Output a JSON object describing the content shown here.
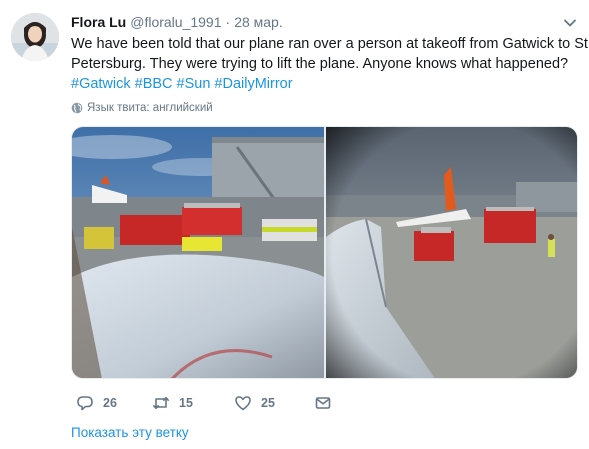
{
  "tweet": {
    "author": {
      "name": "Flora Lu",
      "handle": "@floralu_1991",
      "separator": "·",
      "date": "28 мар."
    },
    "text_lines": [
      "We have been told that our plane ran over a person at takeoff from Gatwick to St",
      "Petersburg. They were trying to lift the plane. Anyone knows what happened?"
    ],
    "hashtags": [
      "#Gatwick",
      "#BBC",
      "#Sun",
      "#DailyMirror"
    ],
    "language_note": "Язык твита: английский",
    "media": {
      "photo_count": 2
    },
    "actions": {
      "replies": "26",
      "retweets": "15",
      "likes": "25"
    },
    "show_thread": "Показать эту ветку"
  },
  "colors": {
    "link": "#1b95e0",
    "secondary_text": "#657786",
    "primary_text": "#14171a",
    "border": "#e6ecf0"
  }
}
